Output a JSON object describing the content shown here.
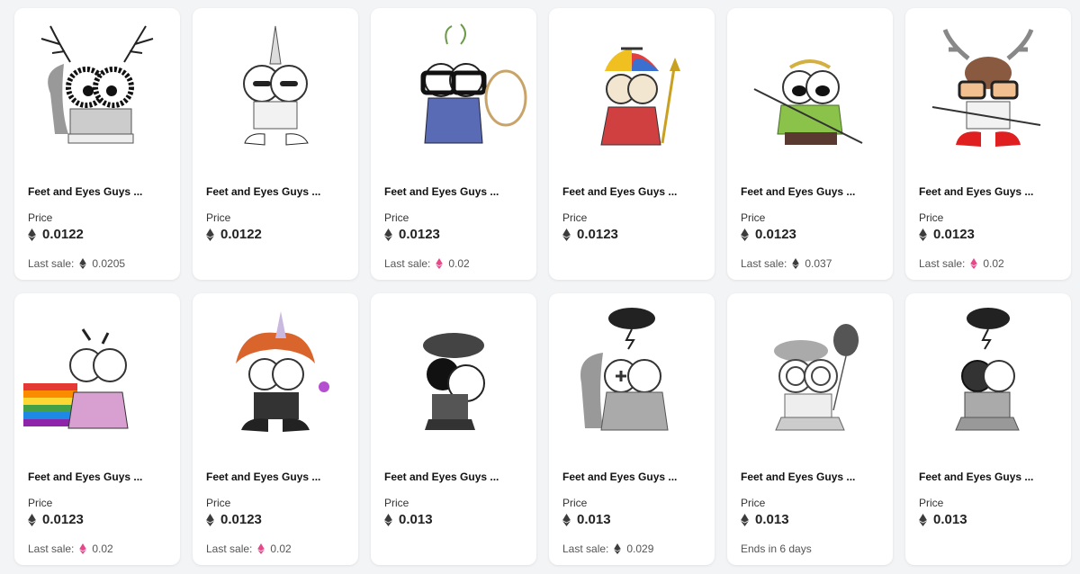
{
  "colors": {
    "eth_dark": "#3c3c3d",
    "eth_pink": "#e6488a",
    "card_bg": "#ffffff",
    "page_bg": "#f3f4f6"
  },
  "price_label": "Price",
  "last_sale_label": "Last sale:",
  "cards": [
    {
      "title": "Feet and Eyes Guys ...",
      "price": "0.0122",
      "footer_text": "Last sale:",
      "footer_value": "0.0205",
      "footer_icon": "eth-dark",
      "art": "antlers"
    },
    {
      "title": "Feet and Eyes Guys ...",
      "price": "0.0122",
      "footer_text": "",
      "footer_value": "",
      "footer_icon": "",
      "art": "unicorn-horn"
    },
    {
      "title": "Feet and Eyes Guys ...",
      "price": "0.0123",
      "footer_text": "Last sale:",
      "footer_value": "0.02",
      "footer_icon": "eth-pink",
      "art": "glasses-lasso"
    },
    {
      "title": "Feet and Eyes Guys ...",
      "price": "0.0123",
      "footer_text": "",
      "footer_value": "",
      "footer_icon": "",
      "art": "propeller-cap"
    },
    {
      "title": "Feet and Eyes Guys ...",
      "price": "0.0123",
      "footer_text": "Last sale:",
      "footer_value": "0.037",
      "footer_icon": "eth-dark",
      "art": "laurel-wreath"
    },
    {
      "title": "Feet and Eyes Guys ...",
      "price": "0.0123",
      "footer_text": "Last sale:",
      "footer_value": "0.02",
      "footer_icon": "eth-pink",
      "art": "moose"
    },
    {
      "title": "Feet and Eyes Guys ...",
      "price": "0.0123",
      "footer_text": "Last sale:",
      "footer_value": "0.02",
      "footer_icon": "eth-pink",
      "art": "rainbow"
    },
    {
      "title": "Feet and Eyes Guys ...",
      "price": "0.0123",
      "footer_text": "Last sale:",
      "footer_value": "0.02",
      "footer_icon": "eth-pink",
      "art": "orange-hair"
    },
    {
      "title": "Feet and Eyes Guys ...",
      "price": "0.013",
      "footer_text": "",
      "footer_value": "",
      "footer_icon": "",
      "art": "beret-black"
    },
    {
      "title": "Feet and Eyes Guys ...",
      "price": "0.013",
      "footer_text": "Last sale:",
      "footer_value": "0.029",
      "footer_icon": "eth-dark",
      "art": "storm-cloud-squirrel"
    },
    {
      "title": "Feet and Eyes Guys ...",
      "price": "0.013",
      "footer_text": "Ends in 6 days",
      "footer_value": "",
      "footer_icon": "",
      "art": "balloon-beret"
    },
    {
      "title": "Feet and Eyes Guys ...",
      "price": "0.013",
      "footer_text": "",
      "footer_value": "",
      "footer_icon": "",
      "art": "storm-cloud"
    }
  ]
}
